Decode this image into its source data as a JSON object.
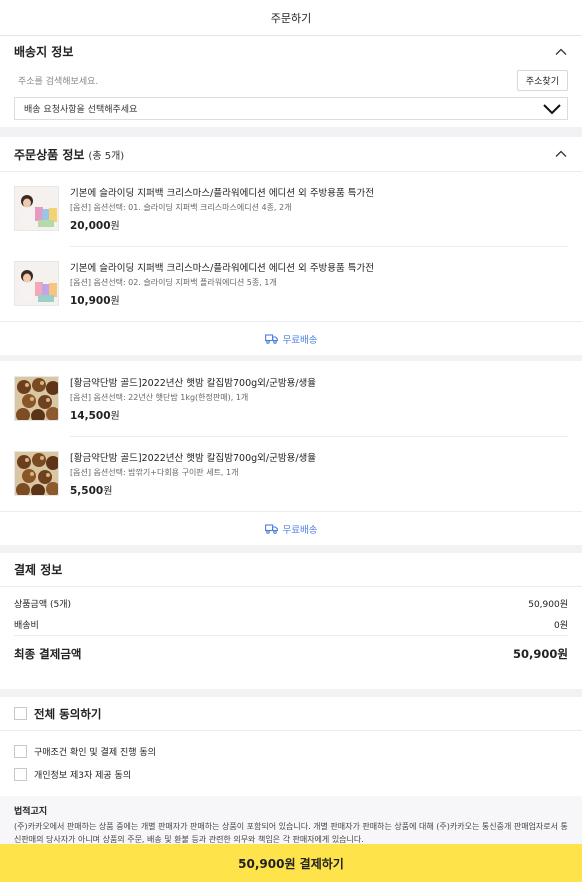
{
  "header": {
    "title": "주문하기"
  },
  "shipping": {
    "title": "배송지 정보",
    "address_placeholder": "주소를 검색해보세요.",
    "find_button": "주소찾기",
    "request_select": "배송 요청사항을 선택해주세요"
  },
  "order": {
    "title": "주문상품 정보",
    "count": "(총 5개)",
    "groups": [
      {
        "items": [
          {
            "name": "기본에 슬라이딩 지퍼백 크리스마스/플라워에디션 에디션 외 주방용품 특가전",
            "option": "[옵션] 옵션선택: 01. 슬라이딩 지퍼백 크리스마스에디션 4종, 2개",
            "price": "20,000",
            "won": "원"
          },
          {
            "name": "기본에 슬라이딩 지퍼백 크리스마스/플라워에디션 에디션 외 주방용품 특가전",
            "option": "[옵션] 옵션선택: 02. 슬라이딩 지퍼백 플라워에디션 5종, 1개",
            "price": "10,900",
            "won": "원"
          }
        ],
        "shipping": "무료배송"
      },
      {
        "items": [
          {
            "name": "[황금약단밤 골드]2022년산 햇밤 칼집밤700g외/군밤용/생율",
            "option": "[옵션] 옵션선택: 22년산 햇단밤 1kg(한정판매), 1개",
            "price": "14,500",
            "won": "원"
          },
          {
            "name": "[황금약단밤 골드]2022년산 햇밤 칼집밤700g외/군밤용/생율",
            "option": "[옵션] 옵션선택: 밤깎기+다회용 구이판 세트, 1개",
            "price": "5,500",
            "won": "원"
          }
        ],
        "shipping": "무료배송"
      }
    ]
  },
  "payment": {
    "title": "결제 정보",
    "product_label": "상품금액 (5개)",
    "product_value": "50,900원",
    "shipping_label": "배송비",
    "shipping_value": "0원",
    "total_label": "최종 결제금액",
    "total_value": "50,900원"
  },
  "agreement": {
    "all": "전체 동의하기",
    "items": [
      "구매조건 확인 및 결제 진행 동의",
      "개인정보 제3자 제공 동의"
    ]
  },
  "legal": {
    "title": "법적고지",
    "body": "(주)카카오에서 판매하는 상품 중에는 개별 판매자가 판매하는 상품이 포함되어 있습니다. 개별 판매자가 판매하는 상품에 대해 (주)카카오는 통신중개 판매업자로서 통신판매의 당사자가 아니며 상품의 주문, 배송 및 환불 등과 관련한 의무와 책임은 각 판매자에게 있습니다."
  },
  "pay_button": "50,900원 결제하기",
  "colors": {
    "accent_yellow": "#fee34a",
    "link_blue": "#4b7ee0"
  }
}
